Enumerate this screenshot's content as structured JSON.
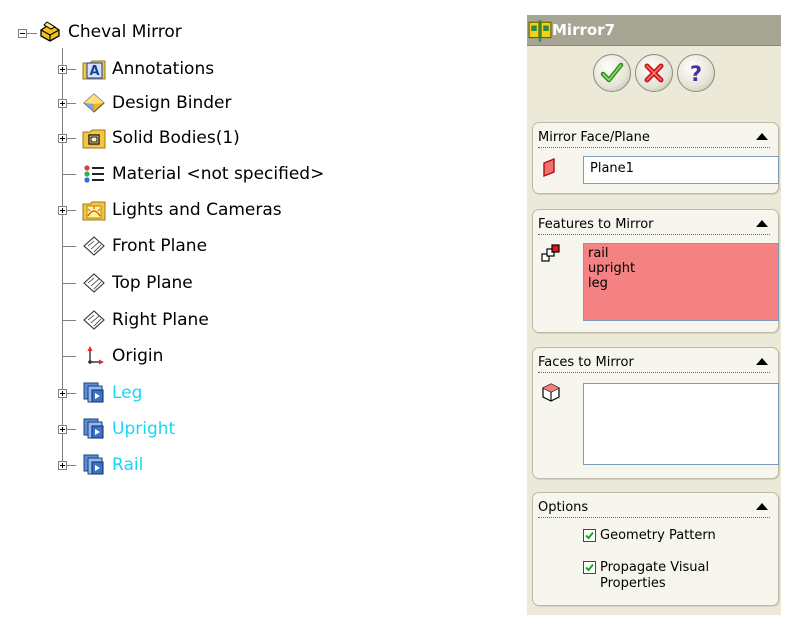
{
  "tree": {
    "root": {
      "label": "Cheval Mirror",
      "icon": "part-icon"
    },
    "items": [
      {
        "label": "Annotations",
        "icon": "annotations-icon",
        "expand": "plus"
      },
      {
        "label": "Design Binder",
        "icon": "design-binder-icon",
        "expand": "plus"
      },
      {
        "label": "Solid Bodies(1)",
        "icon": "solid-bodies-folder-icon",
        "expand": "plus"
      },
      {
        "label": "Material <not specified>",
        "icon": "material-icon",
        "expand": "none"
      },
      {
        "label": "Lights and Cameras",
        "icon": "lights-cameras-icon",
        "expand": "plus"
      },
      {
        "label": "Front Plane",
        "icon": "plane-icon",
        "expand": "none"
      },
      {
        "label": "Top Plane",
        "icon": "plane-icon",
        "expand": "none"
      },
      {
        "label": "Right Plane",
        "icon": "plane-icon",
        "expand": "none"
      },
      {
        "label": "Origin",
        "icon": "origin-icon",
        "expand": "none"
      },
      {
        "label": "Leg",
        "icon": "feature-icon",
        "expand": "plus",
        "color": "#19d6f4"
      },
      {
        "label": "Upright",
        "icon": "feature-icon",
        "expand": "plus",
        "color": "#19d6f4"
      },
      {
        "label": "Rail",
        "icon": "feature-icon",
        "expand": "plus",
        "color": "#19d6f4"
      }
    ]
  },
  "property_manager": {
    "title": "Mirror7",
    "title_icon": "mirror-feature-icon",
    "buttons": {
      "ok": "ok-check-icon",
      "cancel": "cancel-x-icon",
      "help": "help-question-icon"
    },
    "mirror_face_plane": {
      "header": "Mirror Face/Plane",
      "value": "Plane1"
    },
    "features_to_mirror": {
      "header": "Features to Mirror",
      "items": [
        "rail",
        "upright",
        "leg"
      ]
    },
    "faces_to_mirror": {
      "header": "Faces to Mirror",
      "items": []
    },
    "options": {
      "header": "Options",
      "geometry_pattern": {
        "label": "Geometry Pattern",
        "checked": true
      },
      "propagate_visual": {
        "label": "Propagate Visual Properties",
        "line1": "Propagate Visual",
        "line2": "Properties",
        "checked": true
      }
    }
  },
  "colors": {
    "feature_text": "#19d6f4",
    "selection_fill": "#f48282",
    "panel_bg": "#ece9d8"
  }
}
